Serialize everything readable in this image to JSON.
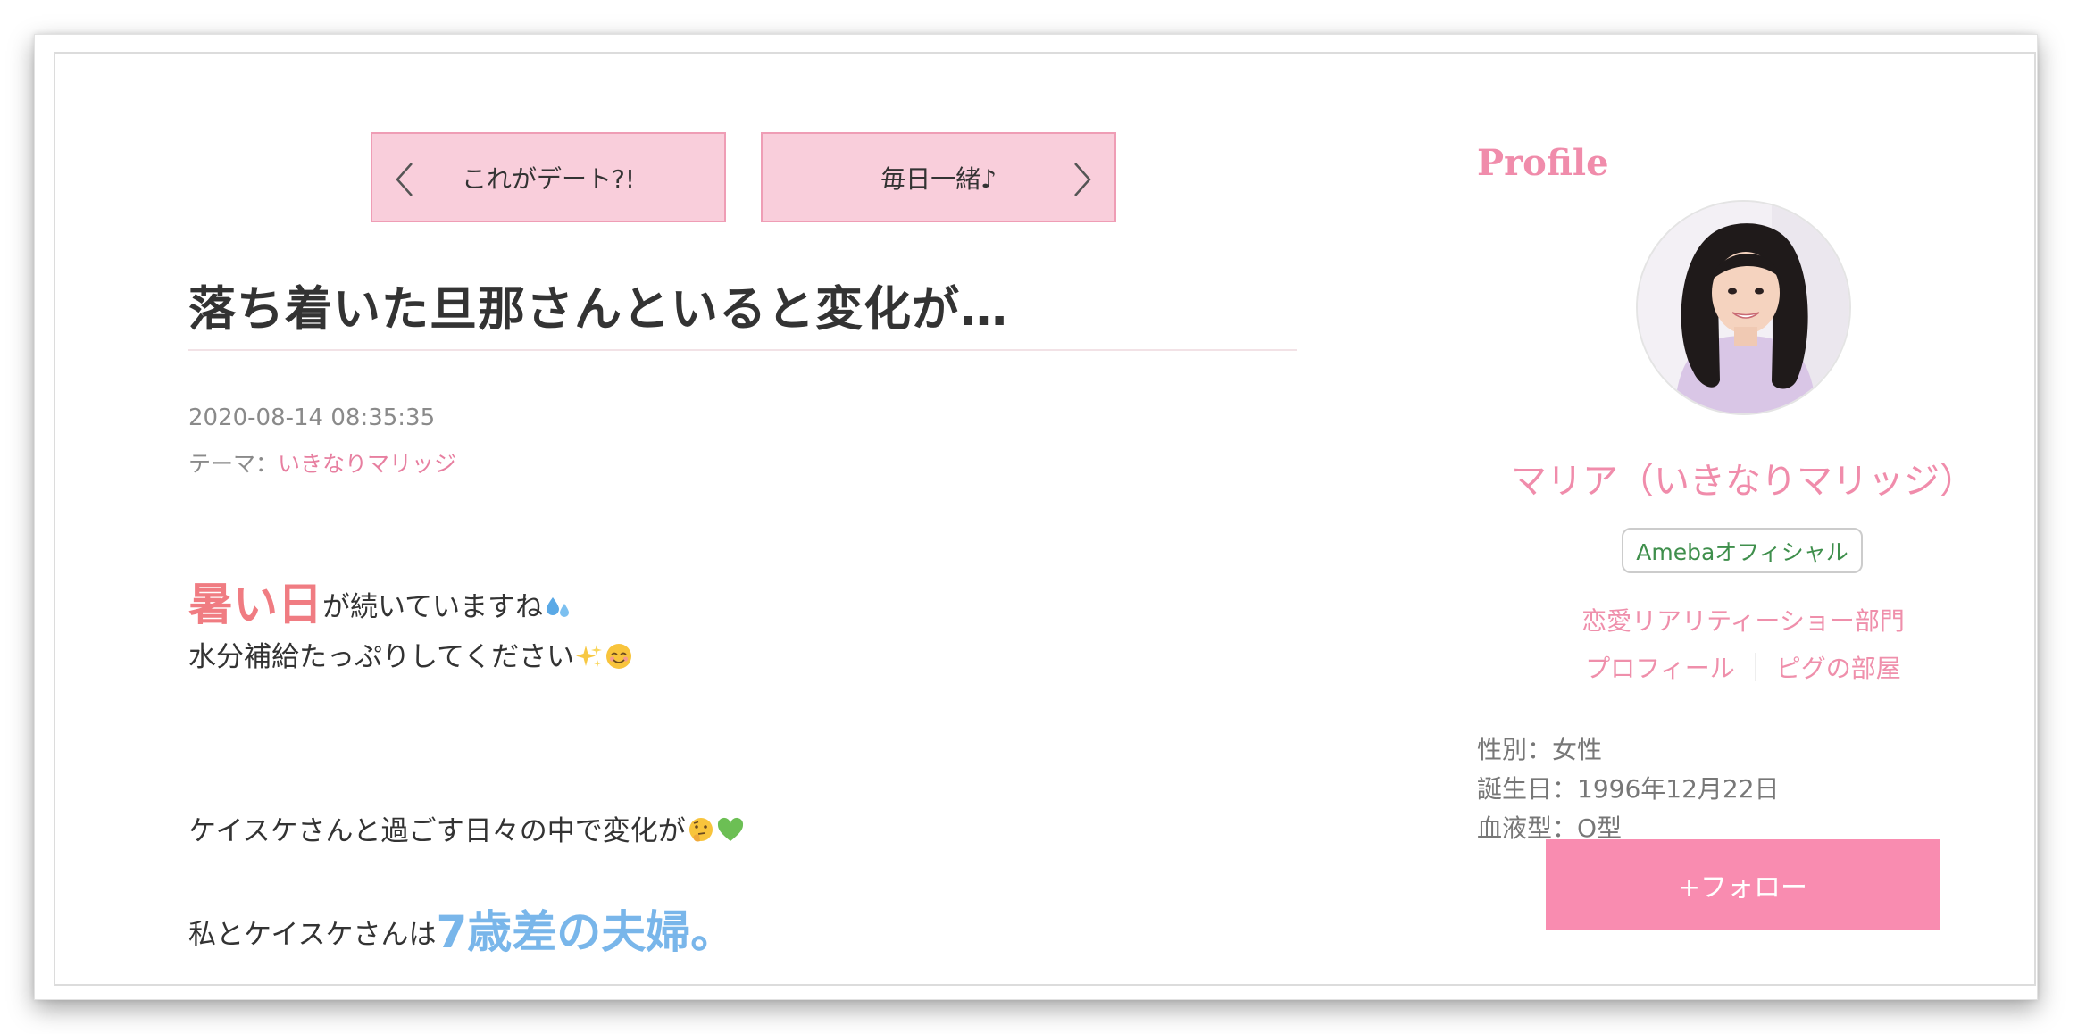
{
  "nav": {
    "prev_label": "これがデート?!",
    "next_label": "毎日一緒♪"
  },
  "article": {
    "title": "落ち着いた旦那さんといると変化が…",
    "date": "2020-08-14 08:35:35",
    "theme_prefix": "テーマ：",
    "theme_link": "いきなりマリッジ",
    "line1_highlight": "暑い日",
    "line1_rest": "が続いていますね",
    "line2": "水分補給たっぷりしてください",
    "line3": "ケイスケさんと過ごす日々の中で変化が",
    "line4_text": "私とケイスケさんは",
    "line4_highlight": "7歳差の夫婦。"
  },
  "profile": {
    "heading": "Profile",
    "name": "マリア（いきなりマリッジ）",
    "badge": "Amebaオフィシャル",
    "category": "恋愛リアリティーショー部門",
    "link_profile": "プロフィール",
    "link_room": "ピグの部屋",
    "gender": "性別：女性",
    "birthday": "誕生日：1996年12月22日",
    "blood": "血液型：O型",
    "follow_label": "+フォロー"
  },
  "colors": {
    "accent_pink": "#f08cab",
    "nav_bg": "#f9cedb",
    "follow_bg": "#f98cb0",
    "highlight_red": "#f07c82",
    "highlight_blue": "#79b6ea",
    "badge_green": "#3f8f4c"
  },
  "icons": [
    "chevron-left-icon",
    "chevron-right-icon",
    "sweat-droplets-icon",
    "sparkles-icon",
    "smiling-face-icon",
    "thinking-face-icon",
    "green-heart-icon"
  ]
}
